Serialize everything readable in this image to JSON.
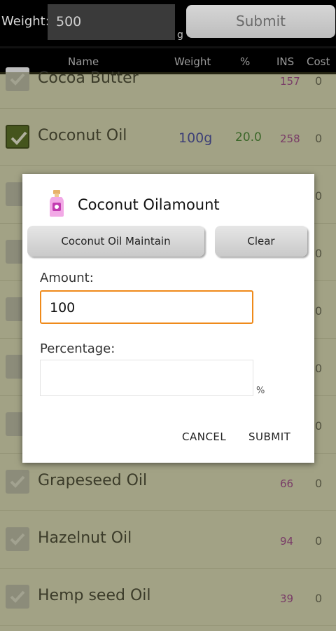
{
  "topbar": {
    "weight_label": "Weight:",
    "weight_value": "500",
    "unit": "g",
    "submit_label": "Submit"
  },
  "columns": {
    "name": "Name",
    "weight": "Weight",
    "percent": "%",
    "ins": "INS",
    "cost": "Cost"
  },
  "oils": [
    {
      "name": "Cocoa Butter",
      "checked": true,
      "weight": "",
      "percent": "",
      "ins": "157",
      "cost": "0"
    },
    {
      "name": "Coconut Oil",
      "checked": true,
      "weight": "100g",
      "percent": "20.0",
      "ins": "258",
      "cost": "0"
    },
    {
      "name": "",
      "checked": true,
      "weight": "",
      "percent": "",
      "ins": "",
      "cost": "0"
    },
    {
      "name": "",
      "checked": true,
      "weight": "",
      "percent": "",
      "ins": "",
      "cost": "0"
    },
    {
      "name": "",
      "checked": true,
      "weight": "",
      "percent": "",
      "ins": "",
      "cost": "0"
    },
    {
      "name": "",
      "checked": true,
      "weight": "",
      "percent": "",
      "ins": "",
      "cost": "0"
    },
    {
      "name": "",
      "checked": true,
      "weight": "",
      "percent": "",
      "ins": "",
      "cost": "0"
    },
    {
      "name": "Grapeseed Oil",
      "checked": true,
      "weight": "",
      "percent": "",
      "ins": "66",
      "cost": "0"
    },
    {
      "name": "Hazelnut Oil",
      "checked": true,
      "weight": "",
      "percent": "",
      "ins": "94",
      "cost": "0"
    },
    {
      "name": "Hemp seed Oil",
      "checked": true,
      "weight": "",
      "percent": "",
      "ins": "39",
      "cost": "0"
    }
  ],
  "dialog": {
    "title": "Coconut Oilamount",
    "icon": "bottle-icon",
    "maintain_label": "Coconut Oil Maintain",
    "clear_label": "Clear",
    "amount_label": "Amount:",
    "amount_value": "100",
    "percentage_label": "Percentage:",
    "percentage_value": "",
    "percent_sign": "%",
    "cancel_label": "CANCEL",
    "submit_label": "SUBMIT"
  }
}
